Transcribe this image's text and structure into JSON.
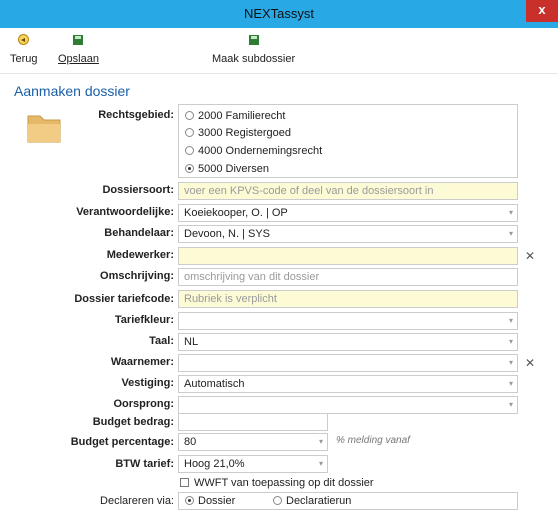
{
  "window": {
    "title": "NEXTassyst",
    "close": "x"
  },
  "toolbar": {
    "back": "Terug",
    "save": "Opslaan",
    "subdossier": "Maak subdossier"
  },
  "form": {
    "heading": "Aanmaken dossier",
    "rechtsgebied": {
      "label": "Rechtsgebied:",
      "options": [
        "2000 Familierecht",
        "3000 Registergoed",
        "4000 Ondernemingsrecht",
        "5000 Diversen"
      ],
      "selected": "5000 Diversen"
    },
    "dossiersoort": {
      "label": "Dossiersoort:",
      "placeholder": "voer een KPVS-code of deel van de dossiersoort in"
    },
    "verantwoordelijke": {
      "label": "Verantwoordelijke:",
      "value": "Koeiekooper, O.   | OP"
    },
    "behandelaar": {
      "label": "Behandelaar:",
      "value": "Devoon, N.  | SYS"
    },
    "medewerker": {
      "label": "Medewerker:",
      "value": ""
    },
    "omschrijving": {
      "label": "Omschrijving:",
      "placeholder": "omschrijving van dit dossier"
    },
    "tariefcode": {
      "label": "Dossier tariefcode:",
      "placeholder": "Rubriek is verplicht"
    },
    "tariefkleur": {
      "label": "Tariefkleur:",
      "value": ""
    },
    "taal": {
      "label": "Taal:",
      "value": "NL"
    },
    "waarnemer": {
      "label": "Waarnemer:",
      "value": ""
    },
    "vestiging": {
      "label": "Vestiging:",
      "value": "Automatisch"
    },
    "oorsprong": {
      "label": "Oorsprong:",
      "value": ""
    },
    "budget_bedrag": {
      "label": "Budget bedrag:",
      "value": ""
    },
    "budget_percentage": {
      "label": "Budget percentage:",
      "value": "80",
      "note": "% melding vanaf"
    },
    "btw_tarief": {
      "label": "BTW tarief:",
      "value": "Hoog 21,0%"
    },
    "wwft": {
      "label": "WWFT van toepassing op dit dossier",
      "checked": false
    },
    "declareren": {
      "label": "Declareren via:",
      "options": [
        "Dossier",
        "Declaratierun"
      ],
      "selected": "Dossier"
    }
  },
  "colors": {
    "titlebar": "#29a8e6",
    "heading": "#1a5fa8",
    "required_field": "#fdfbd6",
    "close": "#c9302c"
  }
}
